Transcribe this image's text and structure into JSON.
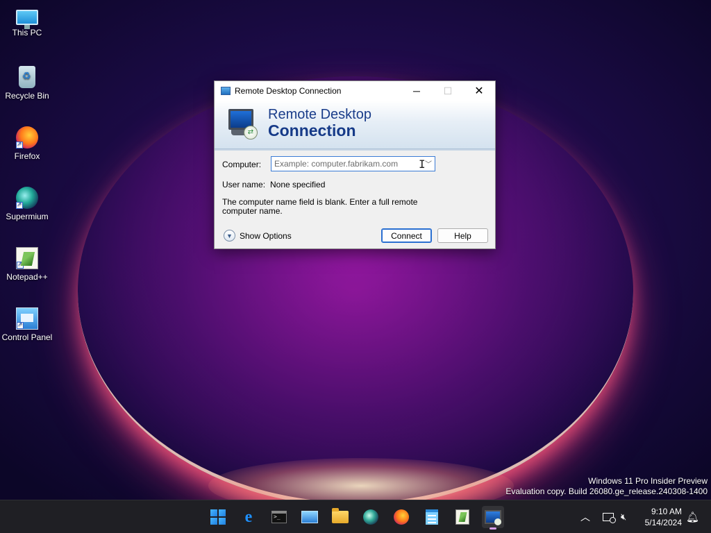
{
  "desktop": {
    "icons": [
      {
        "label": "This PC",
        "icon": "this-pc-icon"
      },
      {
        "label": "Recycle Bin",
        "icon": "recycle-bin-icon"
      },
      {
        "label": "Firefox",
        "icon": "firefox-icon"
      },
      {
        "label": "Supermium",
        "icon": "supermium-icon"
      },
      {
        "label": "Notepad++",
        "icon": "notepad-plus-plus-icon"
      },
      {
        "label": "Control Panel",
        "icon": "control-panel-icon"
      }
    ],
    "watermark": {
      "line1": "Windows 11 Pro Insider Preview",
      "line2": "Evaluation copy. Build 26080.ge_release.240308-1400"
    }
  },
  "window": {
    "title": "Remote Desktop Connection",
    "buttons": {
      "minimize": "─",
      "maximize": "☐",
      "close": "✕"
    },
    "banner": {
      "line1": "Remote Desktop",
      "line2": "Connection"
    },
    "form": {
      "computer_label": "Computer:",
      "computer_value": "",
      "computer_placeholder": "Example: computer.fabrikam.com",
      "username_label": "User name:",
      "username_value": "None specified",
      "message": "The computer name field is blank. Enter a full remote computer name."
    },
    "show_options_label": "Show Options",
    "connect_label": "Connect",
    "help_label": "Help"
  },
  "taskbar": {
    "apps": [
      {
        "name": "start-button",
        "icon": "windows-logo-icon"
      },
      {
        "name": "internet-explorer",
        "icon": "internet-explorer-icon"
      },
      {
        "name": "command-prompt",
        "icon": "terminal-icon"
      },
      {
        "name": "remote-desktop-manager",
        "icon": "rdp-monitor-icon"
      },
      {
        "name": "file-explorer",
        "icon": "folder-icon"
      },
      {
        "name": "supermium",
        "icon": "supermium-icon"
      },
      {
        "name": "firefox",
        "icon": "firefox-icon"
      },
      {
        "name": "notepad",
        "icon": "notepad-icon"
      },
      {
        "name": "notepad-plus-plus",
        "icon": "notepad-plus-plus-icon"
      },
      {
        "name": "remote-desktop-connection",
        "icon": "remote-desktop-icon",
        "active": true
      }
    ],
    "tray": {
      "time": "9:10 AM",
      "date": "5/14/2024"
    }
  },
  "colors": {
    "accent": "#2a6fd1",
    "banner_title": "#1a3d8a",
    "taskbar": "#1f1f24"
  }
}
